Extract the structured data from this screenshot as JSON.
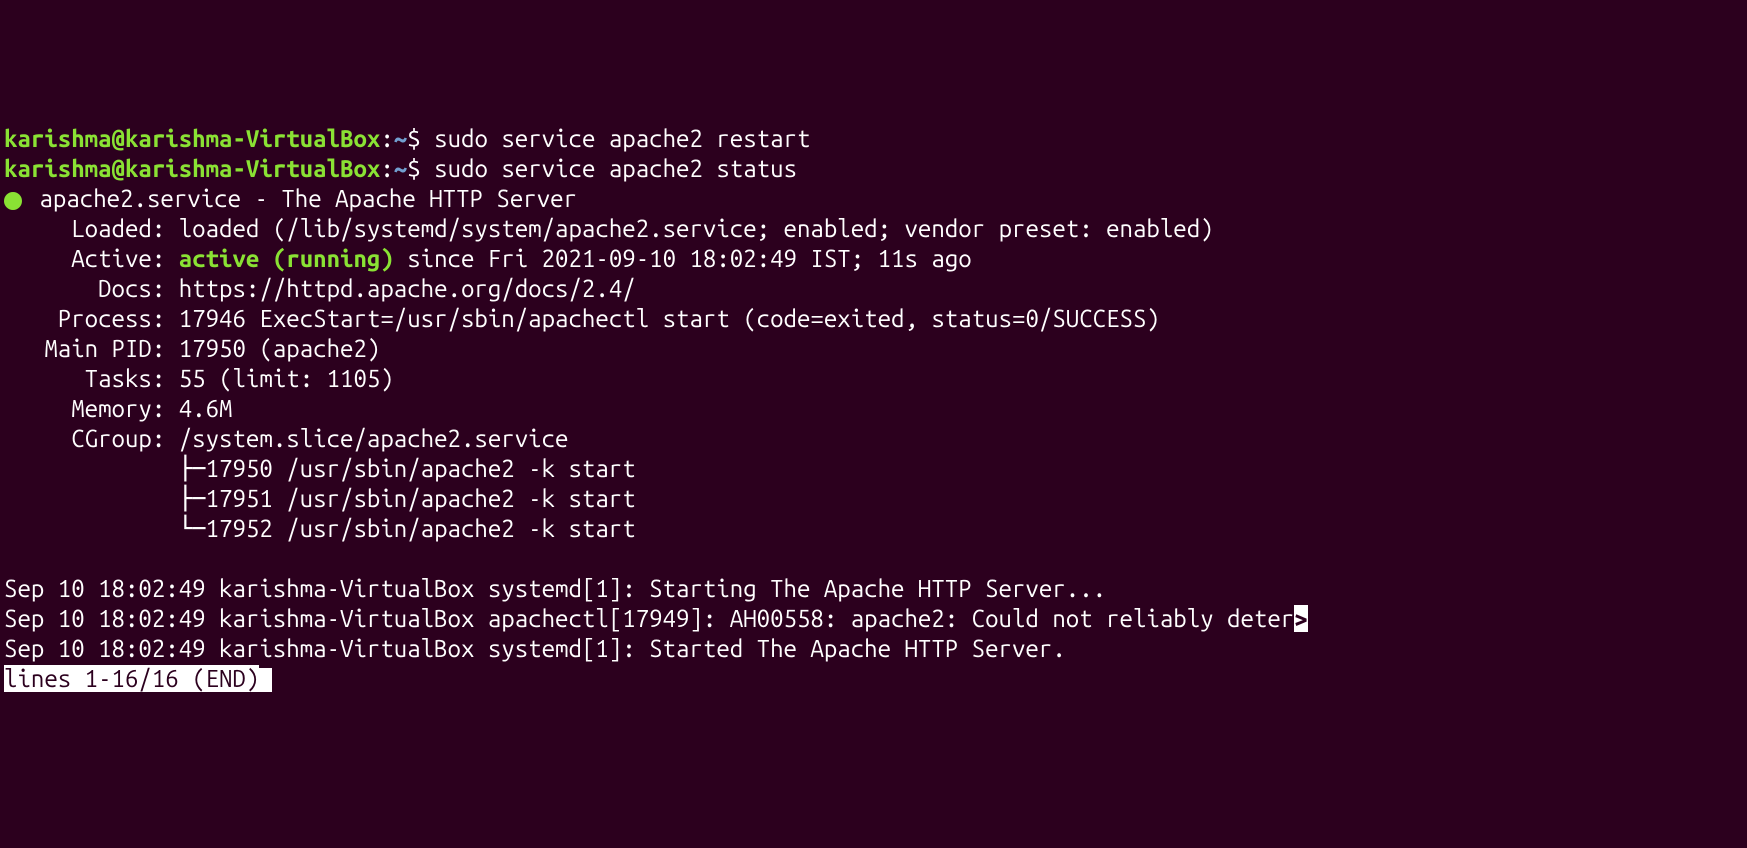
{
  "prompt1": {
    "user_host": "karishma@karishma-VirtualBox",
    "colon": ":",
    "path": "~",
    "dollar": "$",
    "cmd": " sudo service apache2 restart"
  },
  "prompt2": {
    "user_host": "karishma@karishma-VirtualBox",
    "colon": ":",
    "path": "~",
    "dollar": "$",
    "cmd": " sudo service apache2 status"
  },
  "service": {
    "header": " apache2.service - The Apache HTTP Server",
    "loaded_label": "     Loaded: ",
    "loaded_value": "loaded (/lib/systemd/system/apache2.service; enabled; vendor preset: enabled)",
    "active_label": "     Active: ",
    "active_status": "active (running)",
    "active_value": " since Fri 2021-09-10 18:02:49 IST; 11s ago",
    "docs_label": "       Docs: ",
    "docs_value": "https://httpd.apache.org/docs/2.4/",
    "process_label": "    Process: ",
    "process_value": "17946 ExecStart=/usr/sbin/apachectl start (code=exited, status=0/SUCCESS)",
    "mainpid_label": "   Main PID: ",
    "mainpid_value": "17950 (apache2)",
    "tasks_label": "      Tasks: ",
    "tasks_value": "55 (limit: 1105)",
    "memory_label": "     Memory: ",
    "memory_value": "4.6M",
    "cgroup_label": "     CGroup: ",
    "cgroup_value": "/system.slice/apache2.service",
    "tree1": "             ├─17950 /usr/sbin/apache2 -k start",
    "tree2": "             ├─17951 /usr/sbin/apache2 -k start",
    "tree3": "             └─17952 /usr/sbin/apache2 -k start"
  },
  "blank": "",
  "log1": "Sep 10 18:02:49 karishma-VirtualBox systemd[1]: Starting The Apache HTTP Server...",
  "log2": "Sep 10 18:02:49 karishma-VirtualBox apachectl[17949]: AH00558: apache2: Could not reliably deter",
  "log2_more": ">",
  "log3": "Sep 10 18:02:49 karishma-VirtualBox systemd[1]: Started The Apache HTTP Server.",
  "pager": "lines 1-16/16 (END)"
}
